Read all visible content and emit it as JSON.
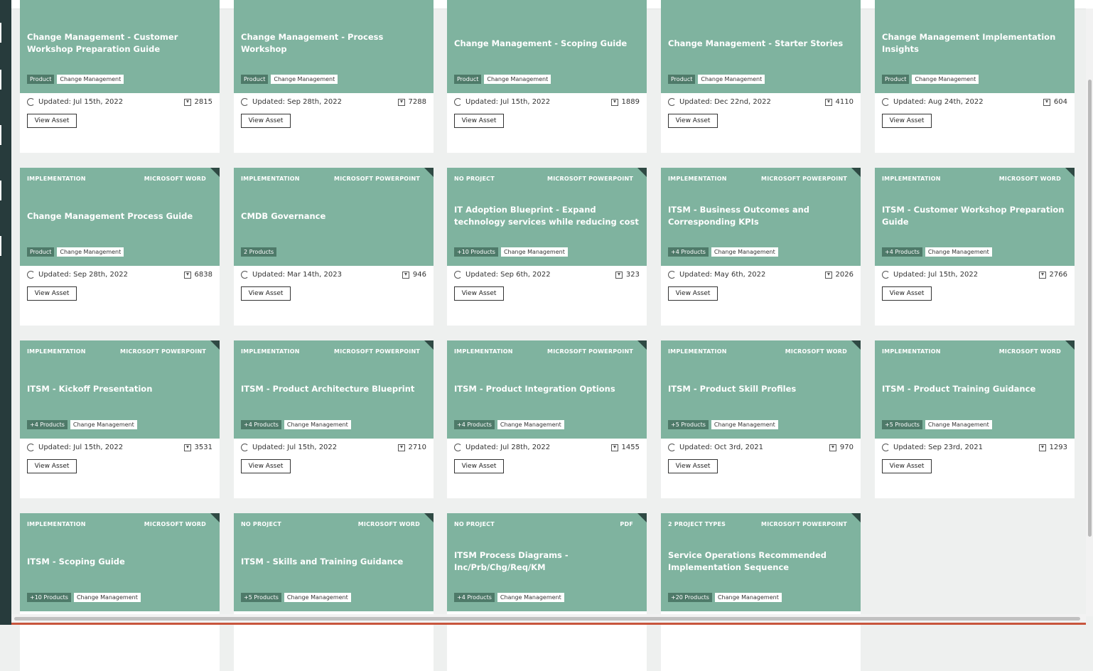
{
  "cards": [
    {
      "meta_left": "",
      "meta_right": "",
      "title": "Change Management - Customer Workshop Preparation Guide",
      "tag_dark": "Product",
      "tag_light": "Change Management",
      "updated": "Updated: Jul 15th, 2022",
      "downloads": "2815",
      "button": "View Asset"
    },
    {
      "meta_left": "",
      "meta_right": "",
      "title": "Change Management - Process Workshop",
      "tag_dark": "Product",
      "tag_light": "Change Management",
      "updated": "Updated: Sep 28th, 2022",
      "downloads": "7288",
      "button": "View Asset"
    },
    {
      "meta_left": "",
      "meta_right": "",
      "title": "Change Management - Scoping Guide",
      "tag_dark": "Product",
      "tag_light": "Change Management",
      "updated": "Updated: Jul 15th, 2022",
      "downloads": "1889",
      "button": "View Asset"
    },
    {
      "meta_left": "",
      "meta_right": "",
      "title": "Change Management - Starter Stories",
      "tag_dark": "Product",
      "tag_light": "Change Management",
      "updated": "Updated: Dec 22nd, 2022",
      "downloads": "4110",
      "button": "View Asset"
    },
    {
      "meta_left": "",
      "meta_right": "",
      "title": "Change Management Implementation Insights",
      "tag_dark": "Product",
      "tag_light": "Change Management",
      "updated": "Updated: Aug 24th, 2022",
      "downloads": "604",
      "button": "View Asset"
    },
    {
      "meta_left": "IMPLEMENTATION",
      "meta_right": "MICROSOFT WORD",
      "title": "Change Management Process Guide",
      "tag_dark": "Product",
      "tag_light": "Change Management",
      "updated": "Updated: Sep 28th, 2022",
      "downloads": "6838",
      "button": "View Asset"
    },
    {
      "meta_left": "IMPLEMENTATION",
      "meta_right": "MICROSOFT POWERPOINT",
      "title": "CMDB Governance",
      "tag_dark": "2 Products",
      "tag_light": "",
      "updated": "Updated: Mar 14th, 2023",
      "downloads": "946",
      "button": "View Asset"
    },
    {
      "meta_left": "NO PROJECT",
      "meta_right": "MICROSOFT POWERPOINT",
      "title": "IT Adoption Blueprint - Expand technology services while reducing cost",
      "tag_dark": "+10 Products",
      "tag_light": "Change Management",
      "updated": "Updated: Sep 6th, 2022",
      "downloads": "323",
      "button": "View Asset"
    },
    {
      "meta_left": "IMPLEMENTATION",
      "meta_right": "MICROSOFT POWERPOINT",
      "title": "ITSM - Business Outcomes and Corresponding KPIs",
      "tag_dark": "+4 Products",
      "tag_light": "Change Management",
      "updated": "Updated: May 6th, 2022",
      "downloads": "2026",
      "button": "View Asset"
    },
    {
      "meta_left": "IMPLEMENTATION",
      "meta_right": "MICROSOFT WORD",
      "title": "ITSM - Customer Workshop Preparation Guide",
      "tag_dark": "+4 Products",
      "tag_light": "Change Management",
      "updated": "Updated: Jul 15th, 2022",
      "downloads": "2766",
      "button": "View Asset"
    },
    {
      "meta_left": "IMPLEMENTATION",
      "meta_right": "MICROSOFT POWERPOINT",
      "title": "ITSM - Kickoff Presentation",
      "tag_dark": "+4 Products",
      "tag_light": "Change Management",
      "updated": "Updated: Jul 15th, 2022",
      "downloads": "3531",
      "button": "View Asset"
    },
    {
      "meta_left": "IMPLEMENTATION",
      "meta_right": "MICROSOFT POWERPOINT",
      "title": "ITSM - Product Architecture Blueprint",
      "tag_dark": "+4 Products",
      "tag_light": "Change Management",
      "updated": "Updated: Jul 15th, 2022",
      "downloads": "2710",
      "button": "View Asset"
    },
    {
      "meta_left": "IMPLEMENTATION",
      "meta_right": "MICROSOFT POWERPOINT",
      "title": "ITSM - Product Integration Options",
      "tag_dark": "+4 Products",
      "tag_light": "Change Management",
      "updated": "Updated: Jul 28th, 2022",
      "downloads": "1455",
      "button": "View Asset"
    },
    {
      "meta_left": "IMPLEMENTATION",
      "meta_right": "MICROSOFT WORD",
      "title": "ITSM - Product Skill Profiles",
      "tag_dark": "+5 Products",
      "tag_light": "Change Management",
      "updated": "Updated: Oct 3rd, 2021",
      "downloads": "970",
      "button": "View Asset"
    },
    {
      "meta_left": "IMPLEMENTATION",
      "meta_right": "MICROSOFT WORD",
      "title": "ITSM - Product Training Guidance",
      "tag_dark": "+5 Products",
      "tag_light": "Change Management",
      "updated": "Updated: Sep 23rd, 2021",
      "downloads": "1293",
      "button": "View Asset"
    },
    {
      "meta_left": "IMPLEMENTATION",
      "meta_right": "MICROSOFT WORD",
      "title": "ITSM - Scoping Guide",
      "tag_dark": "+10 Products",
      "tag_light": "Change Management",
      "updated": "",
      "downloads": "",
      "button": ""
    },
    {
      "meta_left": "NO PROJECT",
      "meta_right": "MICROSOFT WORD",
      "title": "ITSM - Skills and Training Guidance",
      "tag_dark": "+5 Products",
      "tag_light": "Change Management",
      "updated": "",
      "downloads": "",
      "button": ""
    },
    {
      "meta_left": "NO PROJECT",
      "meta_right": "PDF",
      "title": "ITSM Process Diagrams - Inc/Prb/Chg/Req/KM",
      "tag_dark": "+4 Products",
      "tag_light": "Change Management",
      "updated": "",
      "downloads": "",
      "button": ""
    },
    {
      "meta_left": "2 PROJECT TYPES",
      "meta_right": "MICROSOFT POWERPOINT",
      "title": "Service Operations Recommended Implementation Sequence",
      "tag_dark": "+20 Products",
      "tag_light": "Change Management",
      "updated": "",
      "downloads": "",
      "button": ""
    }
  ]
}
